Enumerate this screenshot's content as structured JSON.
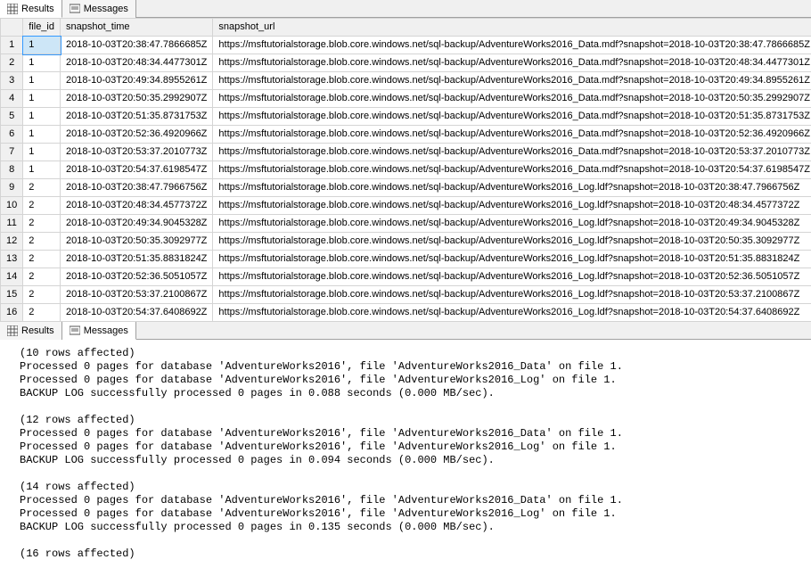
{
  "tabs": {
    "results": "Results",
    "messages": "Messages"
  },
  "grid": {
    "headers": {
      "file_id": "file_id",
      "snapshot_time": "snapshot_time",
      "snapshot_url": "snapshot_url"
    },
    "rows": [
      {
        "n": "1",
        "file_id": "1",
        "snapshot_time": "2018-10-03T20:38:47.7866685Z",
        "snapshot_url": "https://msftutorialstorage.blob.core.windows.net/sql-backup/AdventureWorks2016_Data.mdf?snapshot=2018-10-03T20:38:47.7866685Z"
      },
      {
        "n": "2",
        "file_id": "1",
        "snapshot_time": "2018-10-03T20:48:34.4477301Z",
        "snapshot_url": "https://msftutorialstorage.blob.core.windows.net/sql-backup/AdventureWorks2016_Data.mdf?snapshot=2018-10-03T20:48:34.4477301Z"
      },
      {
        "n": "3",
        "file_id": "1",
        "snapshot_time": "2018-10-03T20:49:34.8955261Z",
        "snapshot_url": "https://msftutorialstorage.blob.core.windows.net/sql-backup/AdventureWorks2016_Data.mdf?snapshot=2018-10-03T20:49:34.8955261Z"
      },
      {
        "n": "4",
        "file_id": "1",
        "snapshot_time": "2018-10-03T20:50:35.2992907Z",
        "snapshot_url": "https://msftutorialstorage.blob.core.windows.net/sql-backup/AdventureWorks2016_Data.mdf?snapshot=2018-10-03T20:50:35.2992907Z"
      },
      {
        "n": "5",
        "file_id": "1",
        "snapshot_time": "2018-10-03T20:51:35.8731753Z",
        "snapshot_url": "https://msftutorialstorage.blob.core.windows.net/sql-backup/AdventureWorks2016_Data.mdf?snapshot=2018-10-03T20:51:35.8731753Z"
      },
      {
        "n": "6",
        "file_id": "1",
        "snapshot_time": "2018-10-03T20:52:36.4920966Z",
        "snapshot_url": "https://msftutorialstorage.blob.core.windows.net/sql-backup/AdventureWorks2016_Data.mdf?snapshot=2018-10-03T20:52:36.4920966Z"
      },
      {
        "n": "7",
        "file_id": "1",
        "snapshot_time": "2018-10-03T20:53:37.2010773Z",
        "snapshot_url": "https://msftutorialstorage.blob.core.windows.net/sql-backup/AdventureWorks2016_Data.mdf?snapshot=2018-10-03T20:53:37.2010773Z"
      },
      {
        "n": "8",
        "file_id": "1",
        "snapshot_time": "2018-10-03T20:54:37.6198547Z",
        "snapshot_url": "https://msftutorialstorage.blob.core.windows.net/sql-backup/AdventureWorks2016_Data.mdf?snapshot=2018-10-03T20:54:37.6198547Z"
      },
      {
        "n": "9",
        "file_id": "2",
        "snapshot_time": "2018-10-03T20:38:47.7966756Z",
        "snapshot_url": "https://msftutorialstorage.blob.core.windows.net/sql-backup/AdventureWorks2016_Log.ldf?snapshot=2018-10-03T20:38:47.7966756Z"
      },
      {
        "n": "10",
        "file_id": "2",
        "snapshot_time": "2018-10-03T20:48:34.4577372Z",
        "snapshot_url": "https://msftutorialstorage.blob.core.windows.net/sql-backup/AdventureWorks2016_Log.ldf?snapshot=2018-10-03T20:48:34.4577372Z"
      },
      {
        "n": "11",
        "file_id": "2",
        "snapshot_time": "2018-10-03T20:49:34.9045328Z",
        "snapshot_url": "https://msftutorialstorage.blob.core.windows.net/sql-backup/AdventureWorks2016_Log.ldf?snapshot=2018-10-03T20:49:34.9045328Z"
      },
      {
        "n": "12",
        "file_id": "2",
        "snapshot_time": "2018-10-03T20:50:35.3092977Z",
        "snapshot_url": "https://msftutorialstorage.blob.core.windows.net/sql-backup/AdventureWorks2016_Log.ldf?snapshot=2018-10-03T20:50:35.3092977Z"
      },
      {
        "n": "13",
        "file_id": "2",
        "snapshot_time": "2018-10-03T20:51:35.8831824Z",
        "snapshot_url": "https://msftutorialstorage.blob.core.windows.net/sql-backup/AdventureWorks2016_Log.ldf?snapshot=2018-10-03T20:51:35.8831824Z"
      },
      {
        "n": "14",
        "file_id": "2",
        "snapshot_time": "2018-10-03T20:52:36.5051057Z",
        "snapshot_url": "https://msftutorialstorage.blob.core.windows.net/sql-backup/AdventureWorks2016_Log.ldf?snapshot=2018-10-03T20:52:36.5051057Z"
      },
      {
        "n": "15",
        "file_id": "2",
        "snapshot_time": "2018-10-03T20:53:37.2100867Z",
        "snapshot_url": "https://msftutorialstorage.blob.core.windows.net/sql-backup/AdventureWorks2016_Log.ldf?snapshot=2018-10-03T20:53:37.2100867Z"
      },
      {
        "n": "16",
        "file_id": "2",
        "snapshot_time": "2018-10-03T20:54:37.6408692Z",
        "snapshot_url": "https://msftutorialstorage.blob.core.windows.net/sql-backup/AdventureWorks2016_Log.ldf?snapshot=2018-10-03T20:54:37.6408692Z"
      }
    ]
  },
  "messages_text": "(10 rows affected)\nProcessed 0 pages for database 'AdventureWorks2016', file 'AdventureWorks2016_Data' on file 1.\nProcessed 0 pages for database 'AdventureWorks2016', file 'AdventureWorks2016_Log' on file 1.\nBACKUP LOG successfully processed 0 pages in 0.088 seconds (0.000 MB/sec).\n\n(12 rows affected)\nProcessed 0 pages for database 'AdventureWorks2016', file 'AdventureWorks2016_Data' on file 1.\nProcessed 0 pages for database 'AdventureWorks2016', file 'AdventureWorks2016_Log' on file 1.\nBACKUP LOG successfully processed 0 pages in 0.094 seconds (0.000 MB/sec).\n\n(14 rows affected)\nProcessed 0 pages for database 'AdventureWorks2016', file 'AdventureWorks2016_Data' on file 1.\nProcessed 0 pages for database 'AdventureWorks2016', file 'AdventureWorks2016_Log' on file 1.\nBACKUP LOG successfully processed 0 pages in 0.135 seconds (0.000 MB/sec).\n\n(16 rows affected)"
}
